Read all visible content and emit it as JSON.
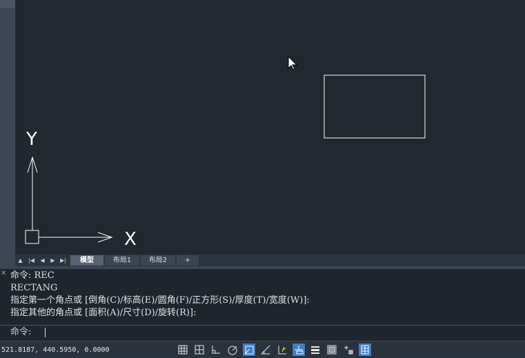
{
  "layout_tabs": {
    "nav": [
      "▲",
      "|◀",
      "◀",
      "▶",
      "▶|"
    ],
    "tabs": [
      "模型",
      "布局1",
      "布局2"
    ],
    "add_label": "+"
  },
  "ucs": {
    "x_label": "X",
    "y_label": "Y"
  },
  "command": {
    "close_icon": "✕",
    "history": "命令: REC\nRECTANG\n指定第一个角点或 [倒角(C)/标高(E)/圆角(F)/正方形(S)/厚度(T)/宽度(W)]:\n指定其他的角点或 [面积(A)/尺寸(D)/旋转(R)]:",
    "prompt": "命令:",
    "value": ""
  },
  "status": {
    "coordinates": "521.8187, 440.5950, 0.0000",
    "toggles": [
      {
        "name": "grid-display-icon",
        "on": false
      },
      {
        "name": "snap-mode-icon",
        "on": false
      },
      {
        "name": "ortho-mode-icon",
        "on": false
      },
      {
        "name": "polar-tracking-icon",
        "on": false
      },
      {
        "name": "object-snap-icon",
        "on": true
      },
      {
        "name": "object-snap-tracking-icon",
        "on": false
      },
      {
        "name": "dynamic-ucs-icon",
        "on": false
      },
      {
        "name": "dynamic-input-icon",
        "on": true
      },
      {
        "name": "lineweight-icon",
        "on": false
      },
      {
        "name": "transparency-icon",
        "on": false
      },
      {
        "name": "selection-cycling-icon",
        "on": false
      },
      {
        "name": "annotation-monitor-icon",
        "on": true
      }
    ]
  },
  "colors": {
    "canvas": "#212830",
    "accent": "#3d7fc4",
    "active_tab": "#566273"
  }
}
